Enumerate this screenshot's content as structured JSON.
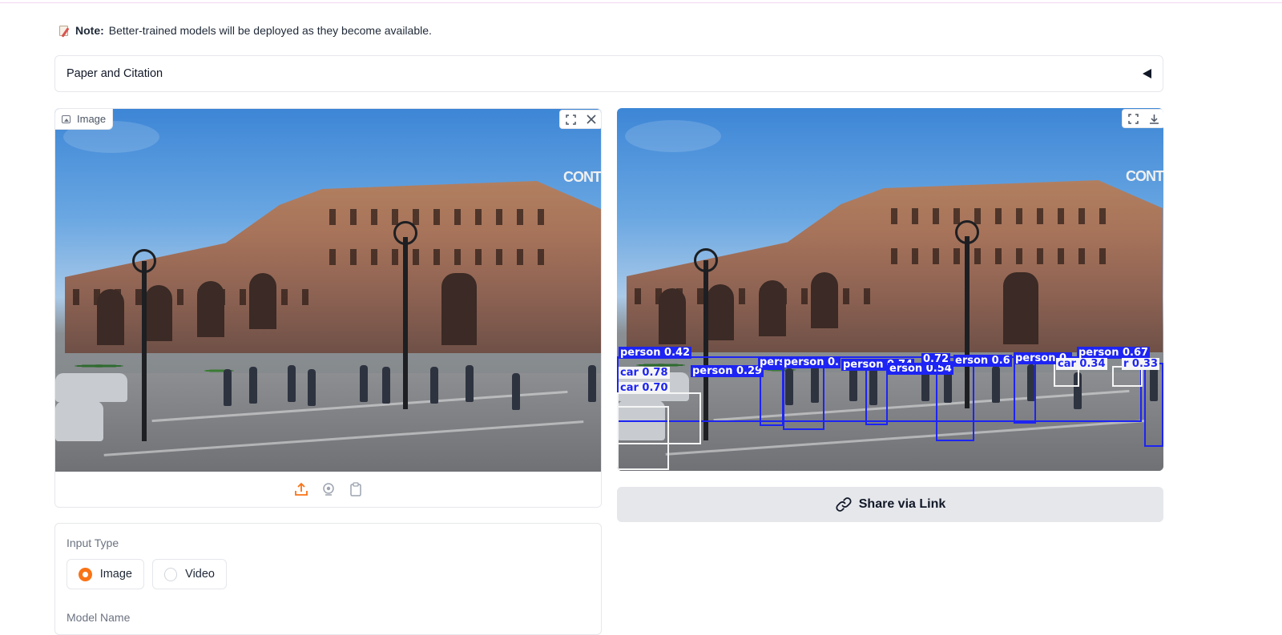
{
  "note": {
    "bold": "Note:",
    "text": "Better-trained models will be deployed as they become available."
  },
  "accordion": {
    "label": "Paper and Citation"
  },
  "input_panel": {
    "label": "Image",
    "sign_text": "CONT"
  },
  "output_panel": {
    "sign_text": "CONT",
    "detections": [
      {
        "label": "person 0.42"
      },
      {
        "label": "car 0.78"
      },
      {
        "label": "car 0.70"
      },
      {
        "label": "person 0.29"
      },
      {
        "label": "pers"
      },
      {
        "label": "person 0."
      },
      {
        "label": "person 0.74"
      },
      {
        "label": "erson 0.54"
      },
      {
        "label": "0.72"
      },
      {
        "label": "erson 0.6"
      },
      {
        "label": "person 0."
      },
      {
        "label": "person 0.67"
      },
      {
        "label": "car 0.34"
      },
      {
        "label": "r 0.33"
      }
    ]
  },
  "share": {
    "label": "Share via Link"
  },
  "form": {
    "input_type_label": "Input Type",
    "options": [
      "Image",
      "Video"
    ],
    "selected": "Image",
    "model_name_label": "Model Name"
  },
  "colors": {
    "accent": "#f97316",
    "box_blue": "#1d24f3",
    "box_white": "#f5f5f5"
  }
}
